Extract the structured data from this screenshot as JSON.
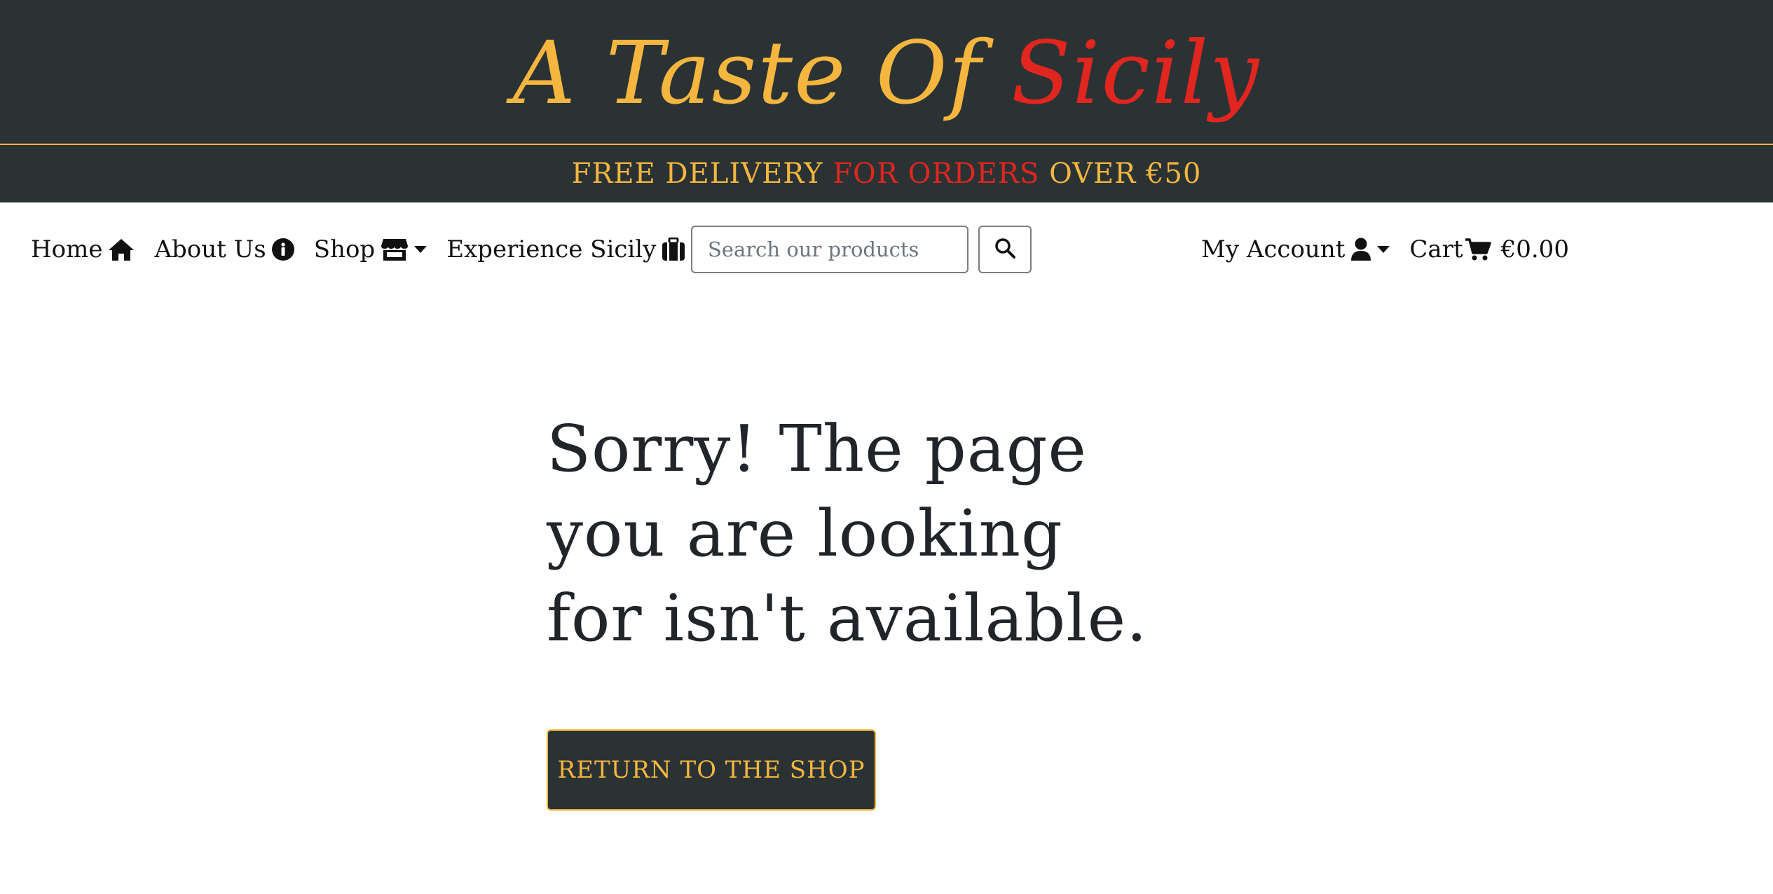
{
  "header": {
    "logo_part1": "A Taste Of ",
    "logo_part2": "Sicily",
    "banner_part1": "FREE DELIVERY ",
    "banner_part2": "FOR ORDERS",
    "banner_part3": " OVER €50",
    "colors": {
      "background": "#2b3234",
      "gold": "#f4b63f",
      "red": "#e0261f"
    }
  },
  "nav": {
    "home": {
      "label": "Home",
      "icon": "home-icon"
    },
    "about": {
      "label": "About Us",
      "icon": "info-circle-icon"
    },
    "shop": {
      "label": "Shop",
      "icon": "store-icon"
    },
    "experience": {
      "label": "Experience Sicily",
      "icon": "suitcase-icon"
    },
    "search": {
      "placeholder": "Search our products",
      "icon": "search-icon"
    },
    "account": {
      "label": "My Account",
      "icon": "user-icon"
    },
    "cart": {
      "label": "Cart",
      "icon": "cart-icon",
      "total": "€0.00"
    }
  },
  "main": {
    "headline": "Sorry! The page you are looking for isn't available.",
    "return_button": "RETURN TO THE SHOP"
  }
}
